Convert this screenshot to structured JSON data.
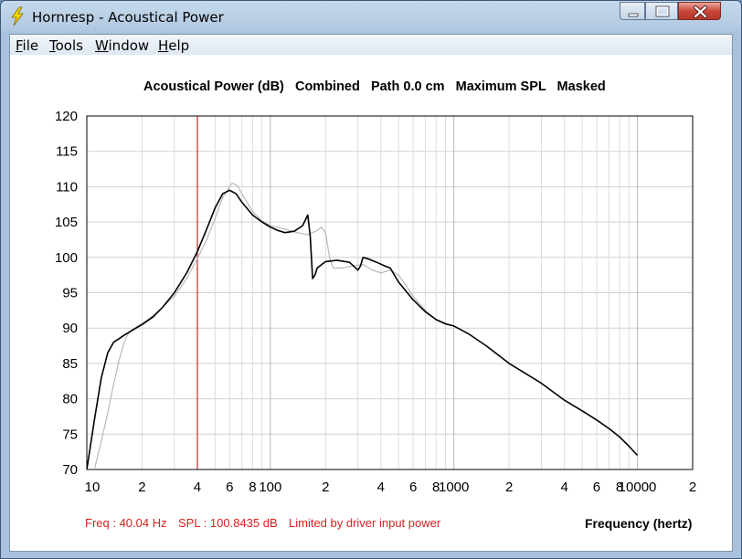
{
  "window": {
    "title": "Hornresp - Acoustical Power",
    "app_icon": "lightning-icon",
    "controls": [
      "minimize-icon",
      "maximize-icon",
      "close-icon"
    ],
    "close_color": "#c9483a"
  },
  "menu": {
    "items": [
      {
        "key": "F",
        "rest": "ile"
      },
      {
        "key": "T",
        "rest": "ools"
      },
      {
        "key": "W",
        "rest": "indow"
      },
      {
        "key": "H",
        "rest": "elp"
      }
    ]
  },
  "header": {
    "text": "Acoustical Power (dB)   Combined   Path 0.0 cm   Maximum SPL   Masked"
  },
  "status": {
    "freq": "Freq : 40.04 Hz",
    "spl": "SPL : 100.8435 dB",
    "limit": "Limited by driver input power",
    "color": "#d82020"
  },
  "chart_data": {
    "type": "line",
    "xlabel": "Frequency (hertz)",
    "ylabel": "",
    "xscale": "log",
    "xlim": [
      10,
      20000
    ],
    "ylim": [
      70,
      120
    ],
    "yticks": [
      120,
      115,
      110,
      105,
      100,
      95,
      90,
      85,
      80,
      75,
      70
    ],
    "xtick_labels": [
      {
        "x": 10,
        "label": "10"
      },
      {
        "x": 20,
        "label": "2"
      },
      {
        "x": 40,
        "label": "4"
      },
      {
        "x": 60,
        "label": "6"
      },
      {
        "x": 80,
        "label": "8"
      },
      {
        "x": 100,
        "label": "100"
      },
      {
        "x": 200,
        "label": "2"
      },
      {
        "x": 400,
        "label": "4"
      },
      {
        "x": 600,
        "label": "6"
      },
      {
        "x": 800,
        "label": "8"
      },
      {
        "x": 1000,
        "label": "1000"
      },
      {
        "x": 2000,
        "label": "2"
      },
      {
        "x": 4000,
        "label": "4"
      },
      {
        "x": 6000,
        "label": "6"
      },
      {
        "x": 8000,
        "label": "8"
      },
      {
        "x": 10000,
        "label": "10000"
      },
      {
        "x": 20000,
        "label": "2"
      }
    ],
    "grid": true,
    "cursor": {
      "x": 40.04,
      "color": "#c00000"
    },
    "series": [
      {
        "color": "#000000",
        "points": [
          [
            10,
            70
          ],
          [
            11,
            77
          ],
          [
            12,
            83
          ],
          [
            13,
            86.5
          ],
          [
            14,
            88
          ],
          [
            16,
            89
          ],
          [
            18,
            89.8
          ],
          [
            20,
            90.5
          ],
          [
            23,
            91.6
          ],
          [
            26,
            93
          ],
          [
            30,
            95
          ],
          [
            35,
            97.8
          ],
          [
            40,
            100.8
          ],
          [
            45,
            104
          ],
          [
            50,
            107
          ],
          [
            55,
            109
          ],
          [
            60,
            109.5
          ],
          [
            65,
            109
          ],
          [
            70,
            107.8
          ],
          [
            80,
            106
          ],
          [
            90,
            105
          ],
          [
            100,
            104.3
          ],
          [
            110,
            103.8
          ],
          [
            120,
            103.5
          ],
          [
            135,
            103.7
          ],
          [
            150,
            104.5
          ],
          [
            160,
            106
          ],
          [
            165,
            103
          ],
          [
            170,
            97
          ],
          [
            175,
            97.5
          ],
          [
            180,
            98.5
          ],
          [
            200,
            99.4
          ],
          [
            230,
            99.6
          ],
          [
            270,
            99.3
          ],
          [
            300,
            98.2
          ],
          [
            310,
            98.8
          ],
          [
            320,
            100
          ],
          [
            340,
            99.8
          ],
          [
            380,
            99.3
          ],
          [
            420,
            98.8
          ],
          [
            450,
            98.5
          ],
          [
            500,
            96.5
          ],
          [
            600,
            94
          ],
          [
            700,
            92.3
          ],
          [
            800,
            91.2
          ],
          [
            900,
            90.6
          ],
          [
            1000,
            90.3
          ],
          [
            1200,
            89.2
          ],
          [
            1500,
            87.5
          ],
          [
            2000,
            85
          ],
          [
            3000,
            82.2
          ],
          [
            4000,
            79.8
          ],
          [
            5000,
            78.3
          ],
          [
            6000,
            77
          ],
          [
            7000,
            75.8
          ],
          [
            8000,
            74.6
          ],
          [
            9000,
            73.3
          ],
          [
            10000,
            72
          ]
        ]
      },
      {
        "color": "#b4b4b4",
        "points": [
          [
            11,
            70
          ],
          [
            12,
            74
          ],
          [
            13,
            78
          ],
          [
            14,
            82
          ],
          [
            15,
            85.5
          ],
          [
            16,
            88
          ],
          [
            17,
            89.5
          ],
          [
            19,
            90.3
          ],
          [
            22,
            91.4
          ],
          [
            26,
            93
          ],
          [
            30,
            94.5
          ],
          [
            35,
            97
          ],
          [
            40,
            99.8
          ],
          [
            45,
            102.5
          ],
          [
            50,
            105.5
          ],
          [
            55,
            108.5
          ],
          [
            60,
            110
          ],
          [
            62,
            110.5
          ],
          [
            66,
            110.2
          ],
          [
            70,
            109
          ],
          [
            80,
            106.5
          ],
          [
            90,
            105.2
          ],
          [
            100,
            104.5
          ],
          [
            120,
            104
          ],
          [
            140,
            103.5
          ],
          [
            160,
            103.2
          ],
          [
            180,
            103.8
          ],
          [
            190,
            104.3
          ],
          [
            200,
            103.5
          ],
          [
            210,
            100
          ],
          [
            220,
            98.5
          ],
          [
            250,
            98.5
          ],
          [
            280,
            98.8
          ],
          [
            320,
            99
          ],
          [
            360,
            98.2
          ],
          [
            400,
            97.8
          ],
          [
            450,
            98.2
          ],
          [
            500,
            97.5
          ],
          [
            550,
            96
          ],
          [
            600,
            94.5
          ],
          [
            700,
            92.5
          ],
          [
            800,
            91.2
          ],
          [
            1000,
            90.3
          ]
        ]
      }
    ]
  }
}
